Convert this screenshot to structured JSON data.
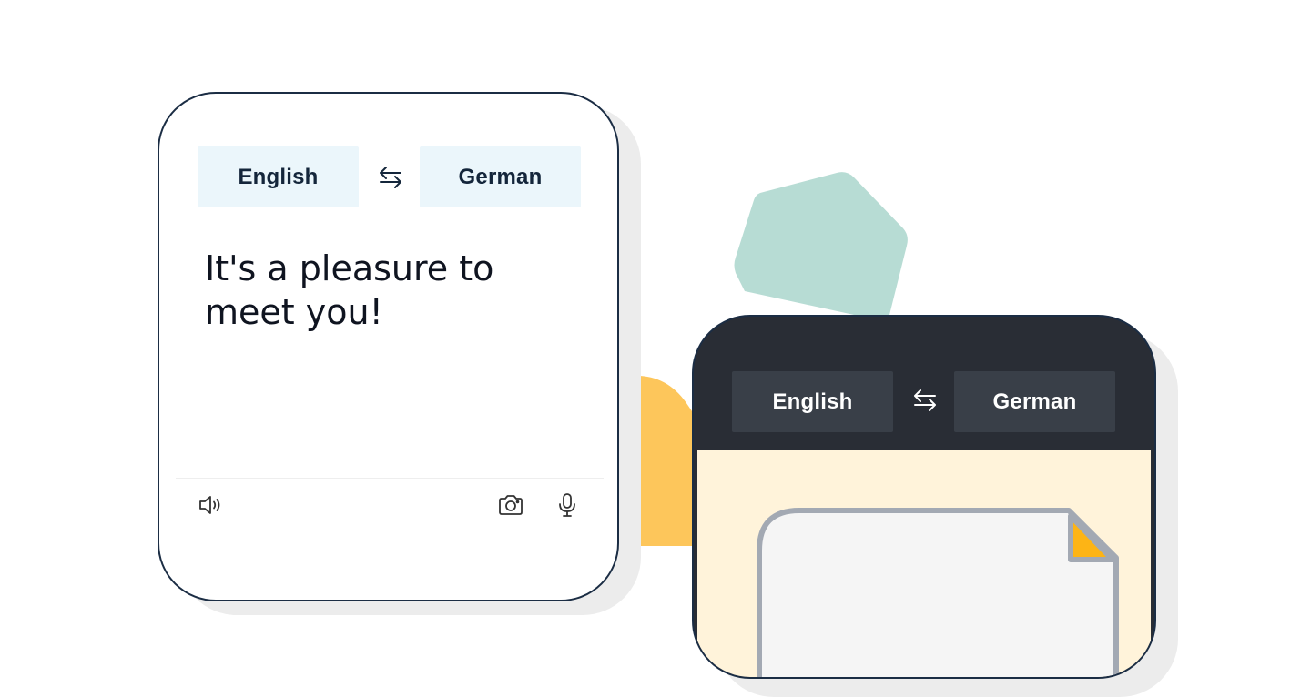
{
  "colors": {
    "accent_yellow": "#fdc65b",
    "accent_mint": "#b7dcd4",
    "dark_phone": "#292d35",
    "border_navy": "#1b2d44",
    "light_lang_bg": "#ebf6fb",
    "dark_lang_bg": "#393f48"
  },
  "phone_light": {
    "source_language": "English",
    "target_language": "German",
    "swap_icon": "swap-arrows-icon",
    "input_text": "It's a pleasure to meet you!",
    "toolbar": {
      "left_icon": "speaker-icon",
      "right_icons": [
        "camera-icon",
        "microphone-icon"
      ]
    }
  },
  "phone_dark": {
    "source_language": "English",
    "target_language": "German",
    "swap_icon": "swap-arrows-icon",
    "content_icon": "document-icon"
  }
}
